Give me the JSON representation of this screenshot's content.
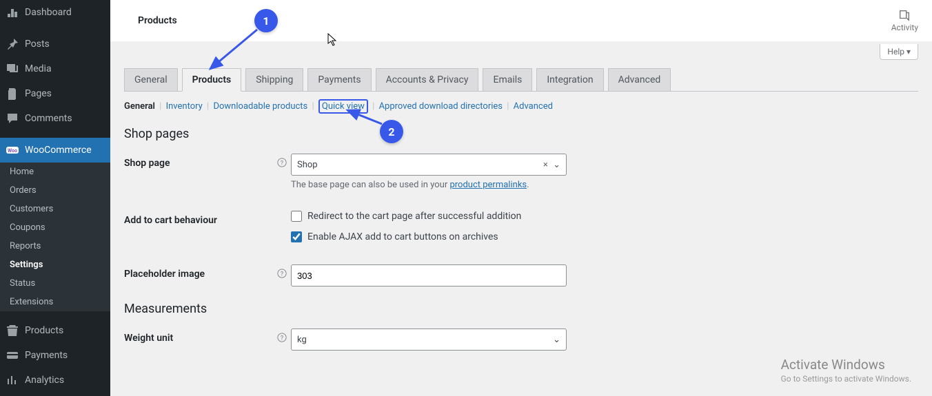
{
  "sidebar": {
    "items": [
      {
        "label": "Dashboard",
        "icon": "dashboard"
      },
      {
        "label": "Posts",
        "icon": "pin"
      },
      {
        "label": "Media",
        "icon": "media"
      },
      {
        "label": "Pages",
        "icon": "pages"
      },
      {
        "label": "Comments",
        "icon": "comments"
      },
      {
        "label": "WooCommerce",
        "icon": "woo",
        "active": true,
        "sub": [
          {
            "label": "Home"
          },
          {
            "label": "Orders"
          },
          {
            "label": "Customers"
          },
          {
            "label": "Coupons"
          },
          {
            "label": "Reports"
          },
          {
            "label": "Settings",
            "current": true
          },
          {
            "label": "Status"
          },
          {
            "label": "Extensions"
          }
        ]
      },
      {
        "label": "Products",
        "icon": "products"
      },
      {
        "label": "Payments",
        "icon": "payments"
      },
      {
        "label": "Analytics",
        "icon": "analytics"
      }
    ]
  },
  "topbar": {
    "title": "Products",
    "activity": "Activity"
  },
  "help": {
    "label": "Help"
  },
  "tabs": [
    {
      "label": "General"
    },
    {
      "label": "Products",
      "active": true
    },
    {
      "label": "Shipping"
    },
    {
      "label": "Payments"
    },
    {
      "label": "Accounts & Privacy"
    },
    {
      "label": "Emails"
    },
    {
      "label": "Integration"
    },
    {
      "label": "Advanced"
    }
  ],
  "subsub": [
    {
      "label": "General",
      "current": true
    },
    {
      "label": "Inventory"
    },
    {
      "label": "Downloadable products"
    },
    {
      "label": "Quick view",
      "highlight": true
    },
    {
      "label": "Approved download directories"
    },
    {
      "label": "Advanced"
    }
  ],
  "sections": {
    "shop_pages": "Shop pages",
    "measurements": "Measurements"
  },
  "fields": {
    "shop_page": {
      "label": "Shop page",
      "value": "Shop",
      "desc_prefix": "The base page can also be used in your ",
      "desc_link": "product permalinks",
      "desc_suffix": "."
    },
    "add_to_cart": {
      "label": "Add to cart behaviour",
      "redirect": {
        "label": "Redirect to the cart page after successful addition",
        "checked": false
      },
      "ajax": {
        "label": "Enable AJAX add to cart buttons on archives",
        "checked": true
      }
    },
    "placeholder": {
      "label": "Placeholder image",
      "value": "303"
    },
    "weight": {
      "label": "Weight unit",
      "value": "kg"
    }
  },
  "annotations": {
    "one": "1",
    "two": "2"
  },
  "watermark": {
    "t1": "Activate Windows",
    "t2": "Go to Settings to activate Windows."
  }
}
